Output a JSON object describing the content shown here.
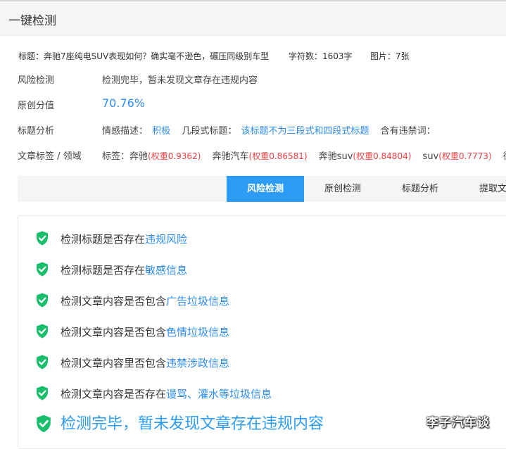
{
  "header": {
    "title": "一键检测"
  },
  "meta": {
    "title_label": "标题：",
    "title_value": "奔驰7座纯电SUV表现如何？确实毫不逊色，碾压同级别车型",
    "chars_label": "字符数：",
    "chars_value": "1603字",
    "images_label": "图片：",
    "images_value": "7张"
  },
  "risk": {
    "label": "风险检测",
    "value": "检测完毕，暂未发现文章存在违规内容"
  },
  "originality": {
    "label": "原创分值",
    "value": "70.76%"
  },
  "title_analysis": {
    "label": "标题分析",
    "sentiment_label": "情感描述：",
    "sentiment_value": "积极",
    "segment_label": "几段式标题：",
    "segment_value": "该标题不为三段式和四段式标题",
    "banned_label": "含有违禁词："
  },
  "tags": {
    "label": "文章标签 / 领域",
    "prefix": "标签：",
    "items": [
      {
        "name": "奔驰",
        "weight": "(权重0.9362)"
      },
      {
        "name": "奔驰汽车",
        "weight": "(权重0.86581)"
      },
      {
        "name": "奔驰suv",
        "weight": "(权重0.84804)"
      },
      {
        "name": "suv",
        "weight": "(权重0.7773)"
      },
      {
        "name": "德国"
      }
    ]
  },
  "tabs": [
    {
      "label": "风险检测",
      "active": true
    },
    {
      "label": "原创检测"
    },
    {
      "label": "标题分析"
    },
    {
      "label": "提取文章"
    }
  ],
  "checks": [
    {
      "text": "检测标题是否存在",
      "link": "违规风险"
    },
    {
      "text": "检测标题是否存在",
      "link": "敏感信息"
    },
    {
      "text": "检测文章内容是否包含",
      "link": "广告垃圾信息"
    },
    {
      "text": "检测文章内容是否包含",
      "link": "色情垃圾信息"
    },
    {
      "text": "检测文章内容里否包含",
      "link": "违禁涉政信息"
    },
    {
      "text": "检测文章内容是否存在",
      "link": "谩骂、灌水等垃圾信息"
    }
  ],
  "final_result": "检测完毕，暂未发现文章存在违规内容",
  "watermark": "李子汽车谈",
  "colors": {
    "accent": "#2d9cf6",
    "link": "#2d8cf0",
    "weight_red": "#ed4040",
    "shield_green": "#19be6b"
  },
  "icons": {
    "check": "shield-check-icon"
  }
}
